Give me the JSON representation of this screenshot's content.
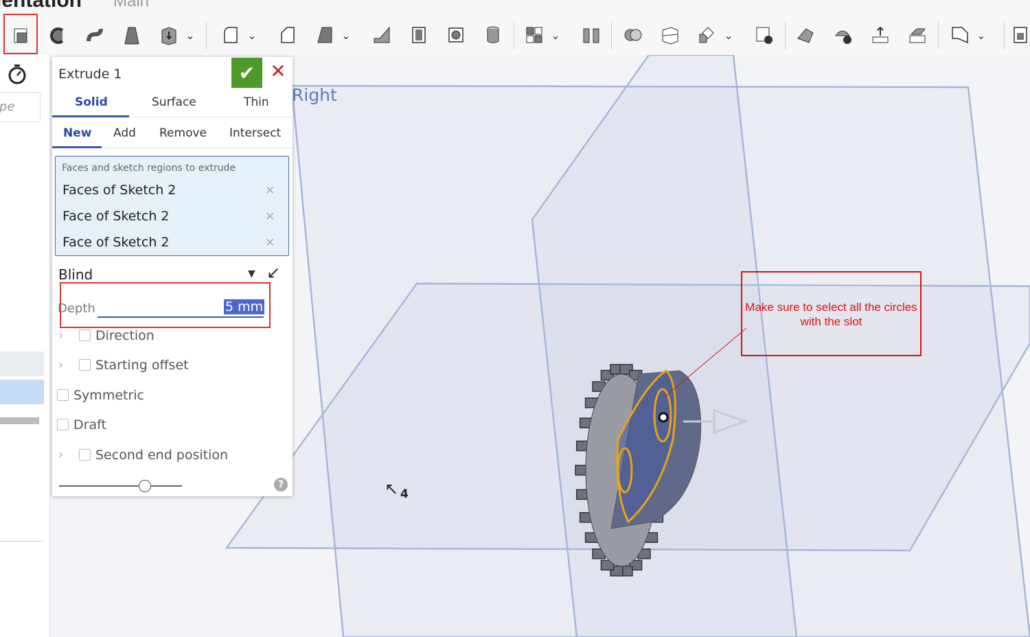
{
  "header": {
    "doc_title": "ientation",
    "workspace": "Main"
  },
  "toolbar": {
    "tools": [
      {
        "icon": "extrude-icon",
        "selected": true
      },
      {
        "icon": "revolve-icon"
      },
      {
        "icon": "sweep-icon"
      },
      {
        "icon": "loft-icon"
      },
      {
        "icon": "thicken-icon",
        "dropdown": true
      },
      {
        "icon": "fillet-icon",
        "dropdown": true
      },
      {
        "icon": "chamfer-icon"
      },
      {
        "icon": "draft-icon",
        "dropdown": true
      },
      {
        "icon": "rib-icon"
      },
      {
        "icon": "shell-icon"
      },
      {
        "icon": "hole-icon"
      },
      {
        "icon": "thread-icon"
      },
      {
        "icon": "pattern-icon",
        "dropdown": true
      },
      {
        "icon": "mirror-icon"
      },
      {
        "icon": "boolean-icon"
      },
      {
        "icon": "split-icon"
      },
      {
        "icon": "transform-icon",
        "dropdown": true
      },
      {
        "icon": "delete-part-icon"
      },
      {
        "icon": "modify-fillet-icon"
      },
      {
        "icon": "delete-face-icon"
      },
      {
        "icon": "move-face-icon"
      },
      {
        "icon": "replace-face-icon"
      },
      {
        "icon": "plane-icon",
        "dropdown": true
      },
      {
        "icon": "mate-connector-icon"
      }
    ]
  },
  "sidebar": {
    "search_placeholder": "pe",
    "timer_icon": "stopwatch-icon"
  },
  "panel": {
    "title": "Extrude 1",
    "confirm_icon": "check-icon",
    "cancel_icon": "close-icon",
    "type_tabs": [
      {
        "label": "Solid",
        "active": true
      },
      {
        "label": "Surface"
      },
      {
        "label": "Thin"
      }
    ],
    "op_tabs": [
      {
        "label": "New",
        "active": true
      },
      {
        "label": "Add"
      },
      {
        "label": "Remove"
      },
      {
        "label": "Intersect"
      }
    ],
    "selection_label": "Faces and sketch regions to extrude",
    "selections": [
      "Faces of Sketch 2",
      "Face of Sketch 2",
      "Face of Sketch 2"
    ],
    "end_type": "Blind",
    "depth_label": "Depth",
    "depth_value": "5 mm",
    "options": [
      {
        "label": "Direction",
        "expandable": true,
        "checked": false
      },
      {
        "label": "Starting offset",
        "expandable": true,
        "checked": false
      },
      {
        "label": "Symmetric",
        "checked": false
      },
      {
        "label": "Draft",
        "checked": false
      },
      {
        "label": "Second end position",
        "expandable": true,
        "checked": false
      }
    ],
    "detail_slider_level": 0.7,
    "help_label": "?"
  },
  "viewport": {
    "plane_label": "Right",
    "annotation": "Make sure to select all the circles with the slot",
    "cursor_badge": "4",
    "colors": {
      "plane": "#9aaed6",
      "selection": "#e8a317",
      "annotation": "#dd1111",
      "part": "#7a7f8c"
    }
  }
}
